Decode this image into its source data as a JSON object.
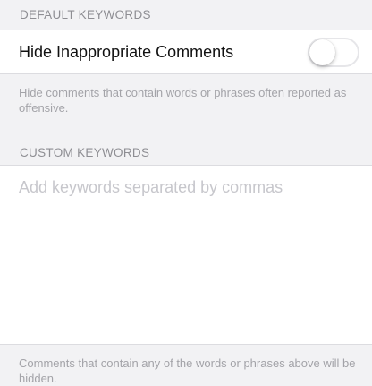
{
  "default_section": {
    "header": "DEFAULT KEYWORDS",
    "toggle_label": "Hide Inappropriate Comments",
    "toggle_on": false,
    "footer": "Hide comments that contain words or phrases often reported as offensive."
  },
  "custom_section": {
    "header": "CUSTOM KEYWORDS",
    "input_placeholder": "Add keywords separated by commas",
    "input_value": "",
    "footer": "Comments that contain any of the words or phrases above will be hidden."
  },
  "colors": {
    "background": "#f2f2f4",
    "header_text": "#8e8e93",
    "footer_text": "#a3a3a8",
    "placeholder": "#c7c7cc"
  }
}
